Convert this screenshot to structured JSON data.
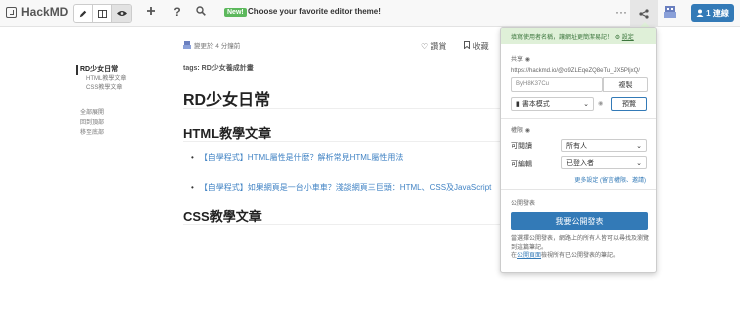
{
  "navbar": {
    "brand": "HackMD",
    "new_badge": "New!",
    "announcement": "Choose your favorite editor theme!",
    "more_label": "···",
    "online_count": "1 連線",
    "icons": {
      "edit": "pencil-icon",
      "both": "columns-icon",
      "view": "eye-icon",
      "add": "plus-icon",
      "help": "question-icon",
      "search": "search-icon",
      "share": "share-icon"
    }
  },
  "toc": {
    "h1": "RD少女日常",
    "h2": [
      "HTML教學文章",
      "CSS教學文章"
    ],
    "links": [
      "全部展開",
      "回到頂部",
      "移至底部"
    ]
  },
  "doc": {
    "updated": "變更於 4 分鐘前",
    "actions": [
      "讚賞",
      "收藏"
    ],
    "tags": "tags: RD少女養成計畫",
    "title": "RD少女日常",
    "sections": [
      {
        "heading": "HTML教學文章",
        "items": [
          "【自學程式】HTML屬性是什麼？解析常見HTML屬性用法",
          "【自學程式】如果網頁是一台小車車？淺談網頁三巨頭：HTML、CSS及JavaScript"
        ]
      },
      {
        "heading": "CSS教學文章",
        "items": []
      }
    ]
  },
  "share_popover": {
    "notice": "填寫使用者名稱，讓網址更簡潔易記！",
    "notice_link": "設定",
    "share_label": "共享",
    "url": "https://hackmd.io/@o9ZLEqeZQ8eTu_JX5PljxQ/",
    "copy_value": "ByH8K37Cu",
    "copy_button": "複製",
    "mode_option": "書本模式",
    "preview_button": "預覽",
    "permission_label": "權限",
    "read_label": "可閱讀",
    "read_value": "所有人",
    "write_label": "可編輯",
    "write_value": "已登入者",
    "more_settings": "更多設定 (留言權限、邀請)",
    "publish_label": "公開發表",
    "publish_button": "我要公開發表",
    "publish_desc": "當選擇公開發表，網路上的所有人皆可以尋找及瀏覽到這篇筆記。",
    "publish_desc_prefix": "在",
    "publish_link": "公開頁面",
    "publish_desc_suffix": "檢視所有已公開發表的筆記。"
  }
}
